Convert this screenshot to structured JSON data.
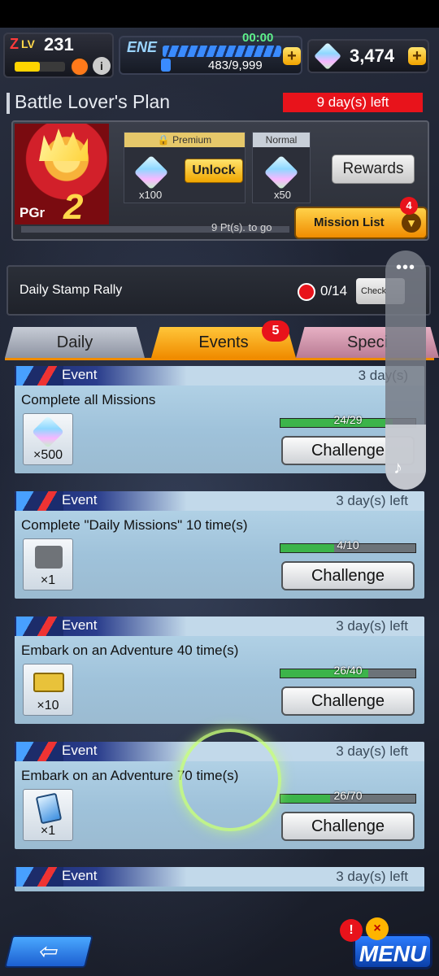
{
  "hud": {
    "level_label": "LV",
    "level": "231",
    "level_progress": 0.5,
    "energy_label": "ENE",
    "energy_timer": "00:00",
    "energy_value": "483/9,999",
    "energy_plus": "+",
    "gems": "3,474",
    "gems_plus": "+",
    "info_label": "i"
  },
  "header": {
    "title": "Battle Lover's Plan",
    "days_left": "9 day(s) left"
  },
  "plan": {
    "pgr_label": "PGr",
    "pgr_value": "2",
    "premium_label": "Premium",
    "premium_count": "x100",
    "unlock_label": "Unlock",
    "normal_label": "Normal",
    "normal_count": "x50",
    "rewards_label": "Rewards",
    "points_to_go": "9 Pt(s). to go",
    "points_progress": 0.0,
    "mission_list_label": "Mission List",
    "mission_badge": "4"
  },
  "stamp": {
    "title": "Daily Stamp Rally",
    "count": "0/14",
    "check_label": "Check"
  },
  "tabs": [
    {
      "label": "Daily"
    },
    {
      "label": "Events"
    },
    {
      "label": "Speci"
    }
  ],
  "tab_badge": "5",
  "missions": [
    {
      "tag": "Event",
      "days": "3 day(s)",
      "title": "Complete all Missions",
      "reward_icon": "crystal-icon",
      "reward_count": "×500",
      "progress_text": "24/29",
      "progress": 0.83,
      "button": "Challenge"
    },
    {
      "tag": "Event",
      "days": "3 day(s) left",
      "title": "Complete \"Daily Missions\" 10 time(s)",
      "reward_icon": "chat-icon",
      "reward_count": "×1",
      "progress_text": "4/10",
      "progress": 0.4,
      "button": "Challenge"
    },
    {
      "tag": "Event",
      "days": "3 day(s) left",
      "title": "Embark on an Adventure 40 time(s)",
      "reward_icon": "ticket-icon",
      "reward_count": "×10",
      "progress_text": "26/40",
      "progress": 0.65,
      "button": "Challenge"
    },
    {
      "tag": "Event",
      "days": "3 day(s) left",
      "title": "Embark on an Adventure 70 time(s)",
      "reward_icon": "card-icon",
      "reward_count": "×1",
      "progress_text": "26/70",
      "progress": 0.37,
      "button": "Challenge"
    },
    {
      "tag": "Event",
      "days": "3 day(s) left"
    }
  ],
  "float_widget": {
    "dots": "•••",
    "note": "♪"
  },
  "bottom": {
    "back_label": "⇦",
    "menu_label": "MENU",
    "alert_1": "!",
    "alert_2": "×"
  }
}
